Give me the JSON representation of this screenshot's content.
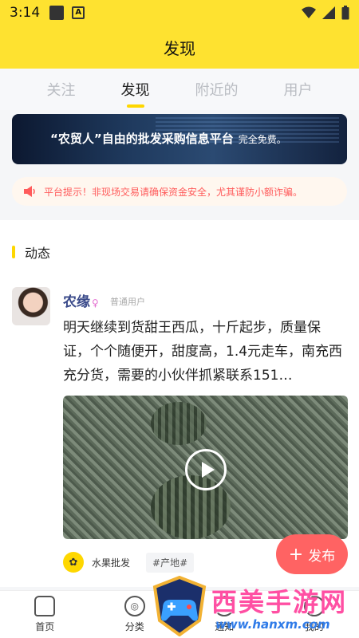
{
  "status_bar": {
    "time": "3:14"
  },
  "header": {
    "title": "发现"
  },
  "tabs": [
    {
      "label": "关注"
    },
    {
      "label": "发现"
    },
    {
      "label": "附近的"
    },
    {
      "label": "用户"
    }
  ],
  "banner": {
    "text": "“农贸人”自由的批发采购信息平台",
    "subtext": "完全免费。"
  },
  "notice": {
    "text": "平台提示！非现场交易请确保资金安全，尤其谨防小额诈骗。"
  },
  "section": {
    "title": "动态"
  },
  "post": {
    "username": "农缘",
    "gender_symbol": "♀",
    "user_type": "普通用户",
    "text": "明天继续到货甜王西瓜，十斤起步，质量保证，个个随便开，甜度高，1.4元走车，南充西充分货，需要的小伙伴抓紧联系151…",
    "tag_category": "水果批发",
    "tag_topic": "#产地#"
  },
  "fab": {
    "label": "发布",
    "plus": "+"
  },
  "bottom_nav": [
    {
      "label": "首页",
      "icon": "home-icon"
    },
    {
      "label": "分类",
      "icon": "category-icon"
    },
    {
      "label": "通知",
      "icon": "notification-icon"
    },
    {
      "label": "我的",
      "icon": "profile-icon"
    }
  ],
  "watermark": {
    "text": "西美手游网",
    "url": "www.hanxm.com"
  },
  "colors": {
    "accent": "#fee230",
    "fab": "#ff6363",
    "notice": "#ff5b5b"
  }
}
